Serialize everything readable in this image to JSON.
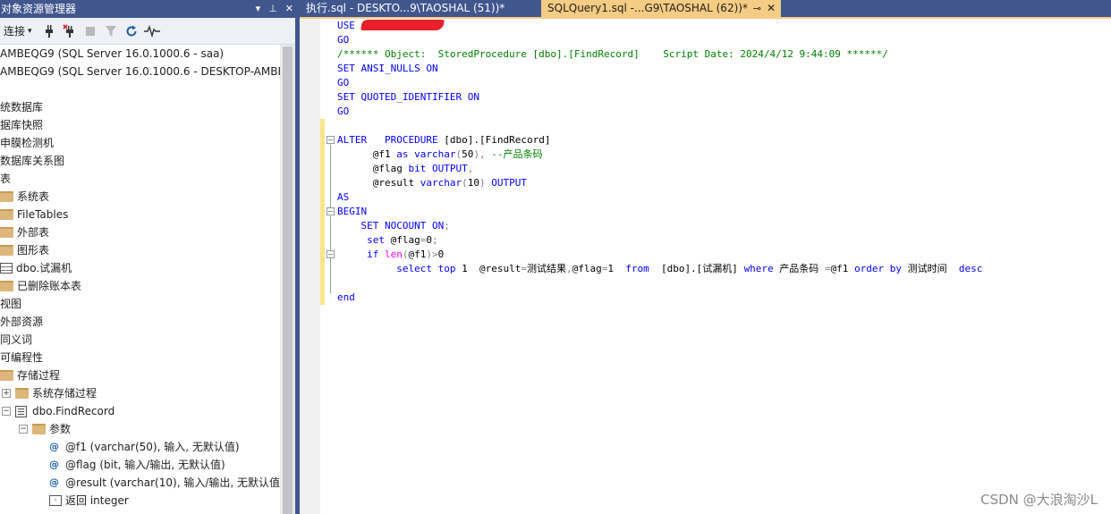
{
  "object_explorer": {
    "title": "对象资源管理器",
    "toolbar": {
      "connect_label": "连接"
    },
    "tree": [
      {
        "label": "AMBEQG9 (SQL Server 16.0.1000.6 - saa)",
        "icon": "server-icon"
      },
      {
        "label": "AMBEQG9 (SQL Server 16.0.1000.6 - DESKTOP-AMBE",
        "icon": "server-icon"
      },
      {
        "label": "",
        "icon": ""
      },
      {
        "label": "统数据库",
        "icon": ""
      },
      {
        "label": "据库快照",
        "icon": ""
      },
      {
        "label": "申膜检测机",
        "icon": ""
      },
      {
        "label": "数据库关系图",
        "icon": ""
      },
      {
        "label": "表",
        "icon": ""
      },
      {
        "label": "系统表",
        "icon": "folder-icon"
      },
      {
        "label": "FileTables",
        "icon": "folder-icon"
      },
      {
        "label": "外部表",
        "icon": "folder-icon"
      },
      {
        "label": "图形表",
        "icon": "folder-icon"
      },
      {
        "label": "dbo.试漏机",
        "icon": "table-icon"
      },
      {
        "label": "已删除账本表",
        "icon": "folder-icon"
      },
      {
        "label": "视图",
        "icon": ""
      },
      {
        "label": "外部资源",
        "icon": ""
      },
      {
        "label": "同义词",
        "icon": ""
      },
      {
        "label": "可编程性",
        "icon": ""
      },
      {
        "label": "存储过程",
        "icon": "folder-icon"
      },
      {
        "label": "系统存储过程",
        "icon": "folder-icon"
      },
      {
        "label": "dbo.FindRecord",
        "icon": "stored-procedure-icon"
      },
      {
        "label": "参数",
        "icon": "folder-icon"
      },
      {
        "label": "@f1 (varchar(50), 输入, 无默认值)",
        "icon": "parameter-icon"
      },
      {
        "label": "@flag (bit, 输入/输出, 无默认值)",
        "icon": "parameter-icon"
      },
      {
        "label": "@result (varchar(10), 输入/输出, 无默认值)",
        "icon": "parameter-icon"
      },
      {
        "label": "返回 integer",
        "icon": "return-value-icon"
      }
    ]
  },
  "tabs": [
    {
      "label": "执行.sql - DESKTO...9\\TAOSHAL (51))*",
      "active": false
    },
    {
      "label": "SQLQuery1.sql -...G9\\TAOSHAL (62))*",
      "active": true
    }
  ],
  "editor": {
    "lines": [
      {
        "segments": [
          [
            "kw",
            "USE "
          ],
          [
            "redact",
            ""
          ]
        ]
      },
      {
        "segments": [
          [
            "kw",
            "GO"
          ]
        ]
      },
      {
        "segments": [
          [
            "cm",
            "/****** Object:  StoredProcedure [dbo].[FindRecord]    Script Date: 2024/4/12 9:44:09 ******/"
          ]
        ]
      },
      {
        "segments": [
          [
            "kw",
            "SET ANSI_NULLS ON"
          ]
        ]
      },
      {
        "segments": [
          [
            "kw",
            "GO"
          ]
        ]
      },
      {
        "segments": [
          [
            "kw",
            "SET QUOTED_IDENTIFIER ON"
          ]
        ]
      },
      {
        "segments": [
          [
            "kw",
            "GO"
          ]
        ]
      },
      {
        "segments": []
      },
      {
        "segments": [
          [
            "kw",
            "ALTER"
          ],
          [
            "tx",
            "   "
          ],
          [
            "kw",
            "PROCEDURE"
          ],
          [
            "tx",
            " [dbo].[FindRecord]"
          ]
        ]
      },
      {
        "segments": [
          [
            "tx",
            "      @f1 "
          ],
          [
            "kw",
            "as varchar"
          ],
          [
            "gr",
            "("
          ],
          [
            "tx",
            "50"
          ],
          [
            "gr",
            "),"
          ],
          [
            "tx",
            " "
          ],
          [
            "cm",
            "--产品条码"
          ]
        ]
      },
      {
        "segments": [
          [
            "tx",
            "      @flag "
          ],
          [
            "kw",
            "bit OUTPUT"
          ],
          [
            "gr",
            ","
          ]
        ]
      },
      {
        "segments": [
          [
            "tx",
            "      @result "
          ],
          [
            "kw",
            "varchar"
          ],
          [
            "gr",
            "("
          ],
          [
            "tx",
            "10"
          ],
          [
            "gr",
            ")"
          ],
          [
            "tx",
            " "
          ],
          [
            "kw",
            "OUTPUT"
          ]
        ]
      },
      {
        "segments": [
          [
            "kw",
            "AS"
          ]
        ]
      },
      {
        "segments": [
          [
            "kw",
            "BEGIN"
          ]
        ]
      },
      {
        "segments": [
          [
            "tx",
            "    "
          ],
          [
            "kw",
            "SET NOCOUNT ON"
          ],
          [
            "gr",
            ";"
          ]
        ]
      },
      {
        "segments": [
          [
            "tx",
            "     "
          ],
          [
            "kw",
            "set"
          ],
          [
            "tx",
            " @flag"
          ],
          [
            "gr",
            "="
          ],
          [
            "tx",
            "0"
          ],
          [
            "gr",
            ";"
          ]
        ]
      },
      {
        "segments": [
          [
            "tx",
            "     "
          ],
          [
            "kw",
            "if"
          ],
          [
            "tx",
            " "
          ],
          [
            "fn",
            "len"
          ],
          [
            "gr",
            "("
          ],
          [
            "tx",
            "@f1"
          ],
          [
            "gr",
            ")>"
          ],
          [
            "tx",
            "0"
          ]
        ]
      },
      {
        "segments": [
          [
            "tx",
            "          "
          ],
          [
            "kw",
            "select top"
          ],
          [
            "tx",
            " 1  @result"
          ],
          [
            "gr",
            "="
          ],
          [
            "tx",
            "测试结果"
          ],
          [
            "gr",
            ","
          ],
          [
            "tx",
            "@flag"
          ],
          [
            "gr",
            "="
          ],
          [
            "tx",
            "1  "
          ],
          [
            "kw",
            "from"
          ],
          [
            "tx",
            "  [dbo].[试漏机] "
          ],
          [
            "kw",
            "where"
          ],
          [
            "tx",
            " 产品条码 "
          ],
          [
            "gr",
            "="
          ],
          [
            "tx",
            "@f1 "
          ],
          [
            "kw",
            "order by"
          ],
          [
            "tx",
            " 测试时间  "
          ],
          [
            "kw",
            "desc"
          ]
        ]
      },
      {
        "segments": []
      },
      {
        "segments": [
          [
            "kw",
            "end"
          ]
        ]
      }
    ]
  },
  "watermark": "CSDN @大浪淘沙L"
}
